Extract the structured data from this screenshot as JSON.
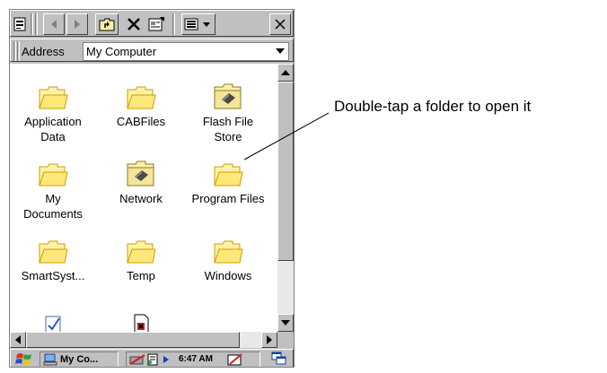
{
  "address": {
    "label": "Address",
    "value": "My Computer"
  },
  "items": [
    {
      "label": "Application\nData",
      "icon": "folder-icon"
    },
    {
      "label": "CABFiles",
      "icon": "folder-icon"
    },
    {
      "label": "Flash File\nStore",
      "icon": "storage-card-folder-icon"
    },
    {
      "label": "My\nDocuments",
      "icon": "folder-icon"
    },
    {
      "label": "Network",
      "icon": "network-folder-icon"
    },
    {
      "label": "Program Files",
      "icon": "folder-icon"
    },
    {
      "label": "SmartSyst...",
      "icon": "folder-icon"
    },
    {
      "label": "Temp",
      "icon": "folder-icon"
    },
    {
      "label": "Windows",
      "icon": "folder-icon"
    }
  ],
  "taskbar": {
    "task_label": "My Co...",
    "clock": "6:47 AM"
  },
  "callout": {
    "text": "Double-tap a folder to open it"
  },
  "colors": {
    "folder": "#fff2a8",
    "folder_outline": "#c8a000",
    "chrome": "#c0c0c0"
  }
}
